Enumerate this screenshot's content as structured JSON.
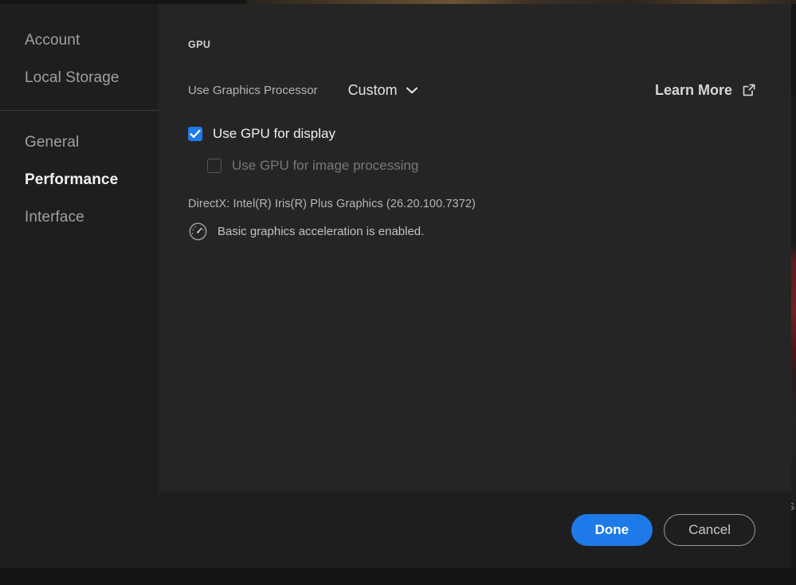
{
  "sidebar": {
    "groups": [
      {
        "items": [
          {
            "label": "Account",
            "selected": false
          },
          {
            "label": "Local Storage",
            "selected": false
          }
        ]
      },
      {
        "items": [
          {
            "label": "General",
            "selected": false
          },
          {
            "label": "Performance",
            "selected": true
          },
          {
            "label": "Interface",
            "selected": false
          }
        ]
      }
    ]
  },
  "content": {
    "section_title": "GPU",
    "graphics_processor": {
      "label": "Use Graphics Processor",
      "value": "Custom",
      "options": [
        "Custom"
      ],
      "chevron_icon": "chevron-down-icon"
    },
    "learn_more": {
      "label": "Learn More",
      "icon": "external-link-icon"
    },
    "checkboxes": [
      {
        "label": "Use GPU for display",
        "checked": true,
        "disabled": false
      },
      {
        "label": "Use GPU for image processing",
        "checked": false,
        "disabled": true
      }
    ],
    "directx_info": "DirectX: Intel(R) Iris(R) Plus Graphics (26.20.100.7372)",
    "status": {
      "icon": "gauge-icon",
      "text": "Basic graphics acceleration is enabled."
    }
  },
  "footer": {
    "done_label": "Done",
    "cancel_label": "Cancel"
  },
  "background": {
    "edge_letter": "S"
  },
  "colors": {
    "accent_blue": "#1e7ae8",
    "panel_bg": "#252525",
    "sidebar_bg": "#1e1e1e",
    "text_primary": "#efefef",
    "text_muted": "#a0a0a0",
    "text_disabled": "#787878"
  }
}
